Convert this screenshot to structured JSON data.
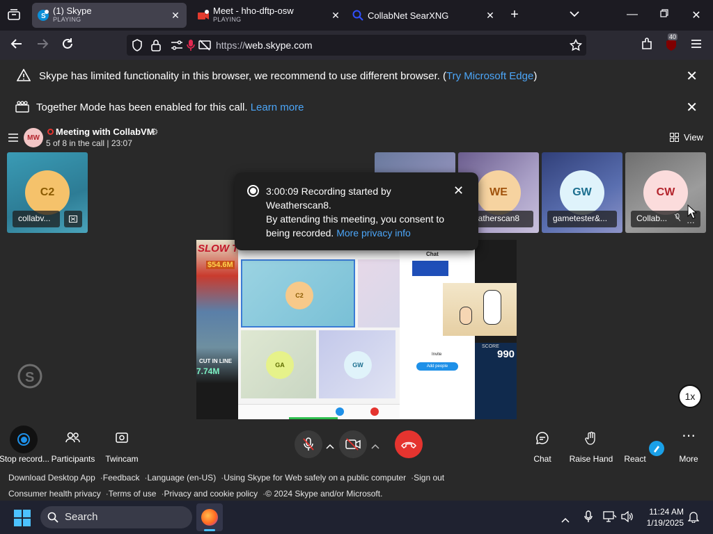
{
  "browser": {
    "tabs": [
      {
        "title": "(1) Skype",
        "sub": "PLAYING",
        "icon": "skype-icon"
      },
      {
        "title": "Meet - hho-dftp-osw",
        "sub": "PLAYING",
        "icon": "meet-icon"
      },
      {
        "title": "CollabNet SearXNG",
        "sub": "",
        "icon": "search-icon"
      }
    ],
    "url_dim": "https://",
    "url_main": "web.skype.com",
    "extension_badge": "40"
  },
  "banners": {
    "browser_warning": "Skype has limited functionality in this browser, we recommend to use different browser. (",
    "browser_warning_link": "Try Microsoft Edge",
    "browser_warning_end": ")",
    "together_mode": "Together Mode has been enabled for this call.",
    "together_mode_link": "Learn more"
  },
  "call": {
    "host_initials": "MW",
    "title": "Meeting with CollabVM",
    "status": "5 of 8 in the call | 23:07",
    "view_label": "View",
    "participants": [
      {
        "initials": "C2",
        "name": "collabv...",
        "bg": "#3a8fa8",
        "avatar_bg": "#f5c26b",
        "avatar_fg": "#8a5a00"
      },
      {
        "initials": "WE",
        "name": "eatherscan8",
        "bg": "#7d6a9e",
        "avatar_bg": "#f6d3a0",
        "avatar_fg": "#a0520b"
      },
      {
        "initials": "GW",
        "name": "gametester&...",
        "bg": "#3d4f8a",
        "avatar_bg": "#dff3fb",
        "avatar_fg": "#1c6f8f"
      },
      {
        "initials": "CW",
        "name": "Collab...",
        "bg": "#7b7b7b",
        "avatar_bg": "#fbdcdc",
        "avatar_fg": "#b3242c"
      }
    ],
    "share_tiles": [
      {
        "initials": "C2"
      },
      {
        "initials": "GA"
      },
      {
        "initials": "GW"
      }
    ],
    "share_text": {
      "slow": "SLOW T",
      "money1": "$54.6M",
      "cut_in_line": "CUT IN LINE",
      "money2": "7.74M",
      "chat_title": "Chat",
      "invite": "Invite",
      "add_people": "Add people",
      "score_label": "SCORE",
      "score": "990"
    },
    "speed_label": "1x"
  },
  "toast": {
    "line1": "3:00:09 Recording started by Weatherscan8.",
    "line2": "By attending this meeting, you consent to being recorded.",
    "link": "More privacy info"
  },
  "controls": {
    "stop_recording": "Stop record...",
    "participants": "Participants",
    "twincam": "Twincam",
    "chat": "Chat",
    "raise_hand": "Raise Hand",
    "react": "React",
    "more": "More"
  },
  "footer": {
    "row1": [
      "Download Desktop App",
      "Feedback",
      "Language (en-US)",
      "Using Skype for Web safely on a public computer",
      "Sign out"
    ],
    "row2": [
      "Consumer health privacy",
      "Terms of use",
      "Privacy and cookie policy",
      "© 2024 Skype and/or Microsoft."
    ]
  },
  "taskbar": {
    "search_label": "Search",
    "time": "11:24 AM",
    "date": "1/19/2025"
  },
  "colors": {
    "end_call": "#e5342f",
    "record_active": "#1e90e8",
    "link": "#4ca6f8"
  }
}
